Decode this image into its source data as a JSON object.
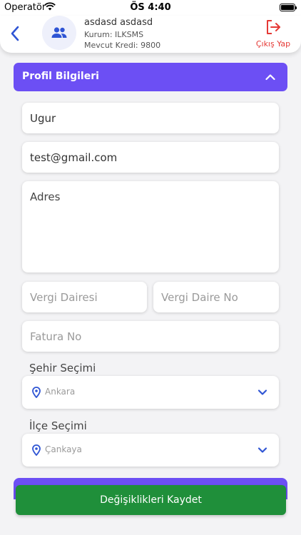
{
  "status_bar": {
    "carrier": "Operatör",
    "time": "ÖS 4:40"
  },
  "header": {
    "user_name": "asdasd asdasd",
    "organization": "Kurum: ILKSMS",
    "credit": "Mevcut Kredi: 9800",
    "logout_label": "Çıkış Yap"
  },
  "section": {
    "title": "Profil Bilgileri"
  },
  "form": {
    "name_value": "Ugur",
    "email_value": "test@gmail.com",
    "address_placeholder": "Adres",
    "tax_office_placeholder": "Vergi Dairesi",
    "tax_number_placeholder": "Vergi Daire No",
    "invoice_placeholder": "Fatura No",
    "city_label": "Şehir Seçimi",
    "city_value": "Ankara",
    "district_label": "İlçe Seçimi",
    "district_value": "Çankaya"
  },
  "actions": {
    "save_label": "Değişiklikleri Kaydet"
  },
  "colors": {
    "accent": "#6c4ff4",
    "save": "#1f8f3a",
    "logout": "#e53935",
    "icon_blue": "#2f55d4"
  }
}
